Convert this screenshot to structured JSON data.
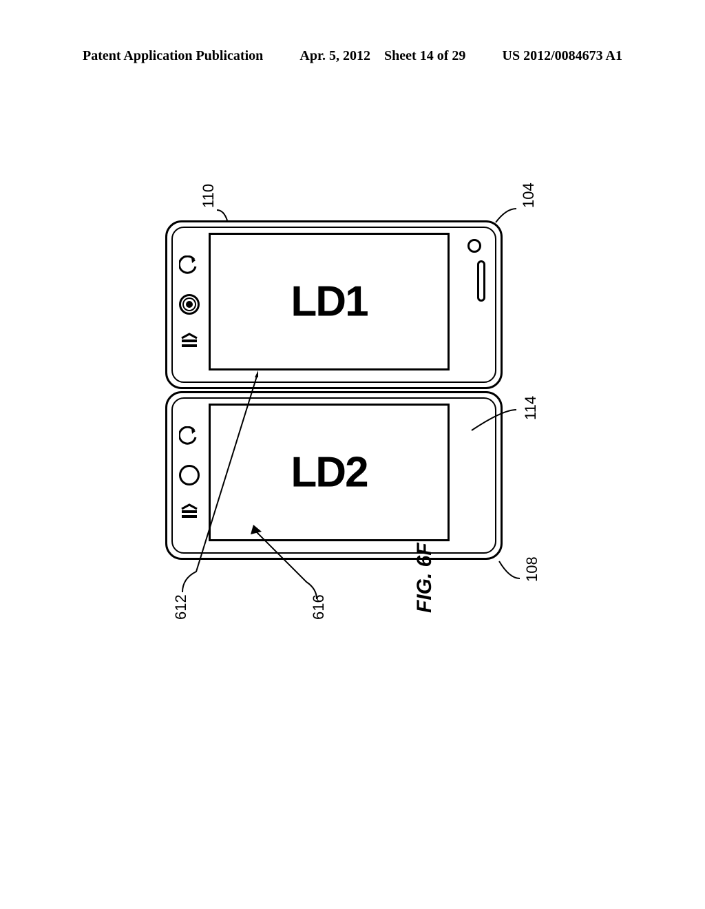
{
  "header": {
    "left": "Patent Application Publication",
    "date": "Apr. 5, 2012",
    "sheet": "Sheet 14 of 29",
    "pubno": "US 2012/0084673 A1"
  },
  "figure": {
    "caption": "FIG. 6F",
    "screen_top_label": "LD1",
    "screen_bottom_label": "LD2",
    "refs": {
      "r104": "104",
      "r108": "108",
      "r110": "110",
      "r114": "114",
      "r612": "612",
      "r616": "616"
    }
  }
}
